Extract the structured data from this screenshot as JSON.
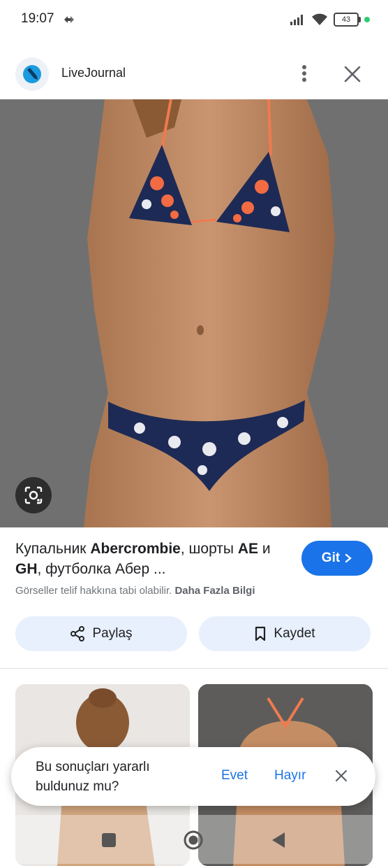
{
  "status_bar": {
    "time": "19:07",
    "battery": "43"
  },
  "source": {
    "name": "LiveJournal"
  },
  "result": {
    "title_parts": [
      "Купальник ",
      "Abercrombie",
      ", шорты ",
      "AE",
      " и ",
      "GH",
      ", футболка Абер ..."
    ],
    "visit_label": "Git",
    "copyright_text": "Görseller telif hakkına tabi olabilir.",
    "more_info": "Daha Fazla Bilgi"
  },
  "actions": {
    "share": "Paylaş",
    "save": "Kaydet"
  },
  "feedback": {
    "question": "Bu sonuçları yararlı buldunuz mu?",
    "yes": "Evet",
    "no": "Hayır"
  },
  "colors": {
    "accent": "#1a73e8",
    "chip_bg": "#e8f0fd",
    "image_bg": "#6f6f6f"
  }
}
